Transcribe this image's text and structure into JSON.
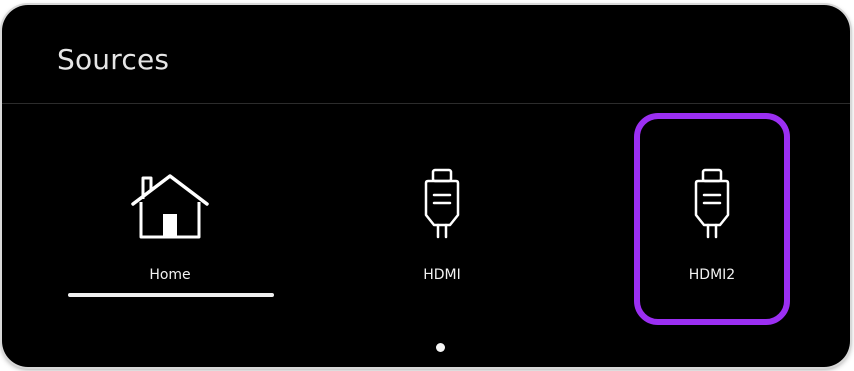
{
  "header": {
    "title": "Sources"
  },
  "sources": [
    {
      "label": "Home",
      "icon": "home-icon"
    },
    {
      "label": "HDMI",
      "icon": "hdmi-icon"
    },
    {
      "label": "HDMI2",
      "icon": "hdmi-icon"
    }
  ],
  "state": {
    "focused": "HDMI2",
    "selected": "Home",
    "page_indicator": {
      "current": 1,
      "total": 1
    }
  },
  "colors": {
    "background": "#000000",
    "focus_ring": "#9b2ff2",
    "text": "#f2f2f2"
  }
}
